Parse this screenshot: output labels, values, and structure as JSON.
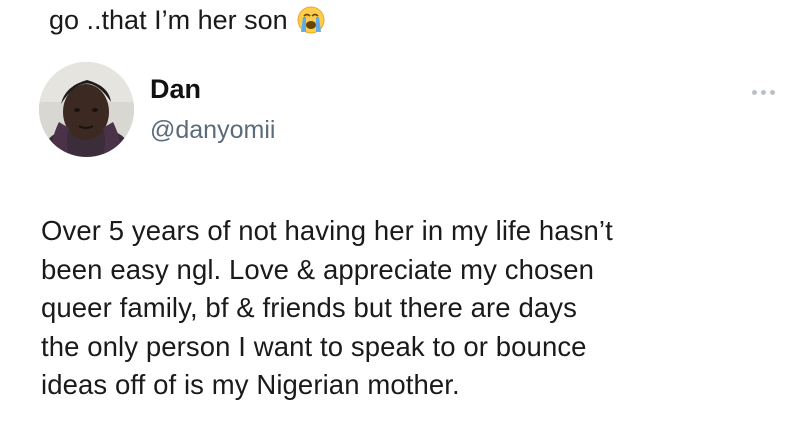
{
  "previous_tweet": {
    "text_tail": "go ..that I’m her son",
    "emoji": "loudly-crying-face-icon"
  },
  "tweet": {
    "author": {
      "display_name": "Dan",
      "handle": "@danyomii"
    },
    "more_icon": "more-options-icon",
    "body_lines": [
      "Over 5 years of not having her in my life hasn’t",
      "been easy ngl. Love & appreciate my chosen",
      "queer family, bf & friends but there are days",
      "the only person I want to speak to or bounce",
      "ideas off of is my Nigerian mother."
    ]
  },
  "colors": {
    "text": "#1a1a1a",
    "handle": "#5b6b79",
    "more_dots": "#b9c1c8",
    "background": "#ffffff"
  }
}
